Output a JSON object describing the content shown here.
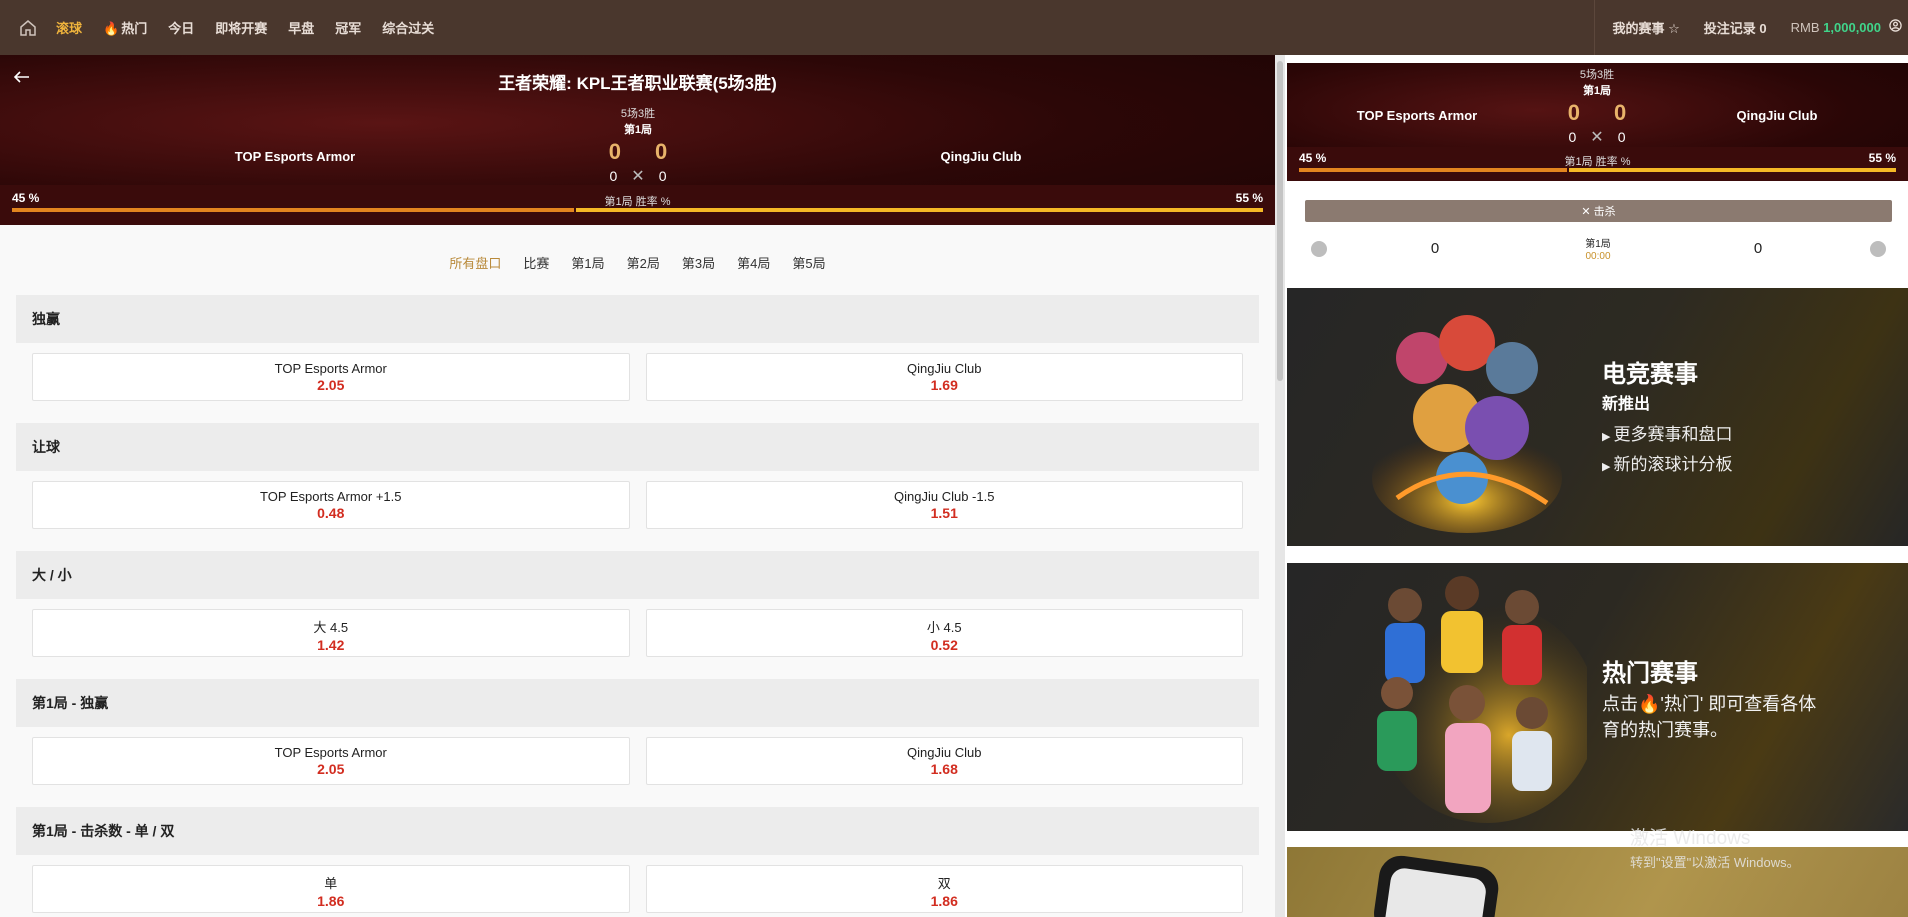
{
  "nav": {
    "items": [
      {
        "label": "滚球",
        "active": true
      },
      {
        "label": "热门",
        "icon": "fire-icon"
      },
      {
        "label": "今日"
      },
      {
        "label": "即将开赛"
      },
      {
        "label": "早盘"
      },
      {
        "label": "冠军"
      },
      {
        "label": "综合过关"
      }
    ],
    "my_events": "我的赛事",
    "bet_records": "投注记录 0",
    "currency": "RMB",
    "balance": "1,000,000"
  },
  "match": {
    "title": "王者荣耀: KPL王者职业联赛(5场3胜)",
    "format": "5场3胜",
    "round": "第1局",
    "home": "TOP Esports Armor",
    "away": "QingJiu Club",
    "home_round_score": "0",
    "away_round_score": "0",
    "home_score": "0",
    "away_score": "0",
    "home_pct_label": "45 %",
    "away_pct_label": "55 %",
    "home_pct": 45,
    "away_pct": 55,
    "prob_label": "第1局 胜率 %"
  },
  "tabs": [
    "所有盘口",
    "比赛",
    "第1局",
    "第2局",
    "第3局",
    "第4局",
    "第5局"
  ],
  "markets": [
    {
      "title": "独赢",
      "options": [
        {
          "name": "TOP Esports Armor",
          "odds": "2.05"
        },
        {
          "name": "QingJiu Club",
          "odds": "1.69"
        }
      ]
    },
    {
      "title": "让球",
      "options": [
        {
          "name": "TOP Esports Armor +1.5",
          "odds": "0.48"
        },
        {
          "name": "QingJiu Club -1.5",
          "odds": "1.51"
        }
      ]
    },
    {
      "title": "大 / 小",
      "options": [
        {
          "name": "大 4.5",
          "odds": "1.42"
        },
        {
          "name": "小 4.5",
          "odds": "0.52"
        }
      ]
    },
    {
      "title": "第1局 - 独赢",
      "options": [
        {
          "name": "TOP Esports Armor",
          "odds": "2.05"
        },
        {
          "name": "QingJiu Club",
          "odds": "1.68"
        }
      ]
    },
    {
      "title": "第1局 - 击杀数 - 单 / 双",
      "options": [
        {
          "name": "单",
          "odds": "1.86"
        },
        {
          "name": "双",
          "odds": "1.86"
        }
      ]
    }
  ],
  "kills": {
    "label": "击杀",
    "home": "0",
    "away": "0",
    "round": "第1局",
    "time": "00:00"
  },
  "promos": {
    "esports_title": "电竞赛事",
    "esports_sub": "新推出",
    "esports_b1": "更多赛事和盘口",
    "esports_b2": "新的滚球计分板",
    "hot_title": "热门赛事",
    "hot_text_pre": "点击",
    "hot_text_post": "'热门' 即可查看各体育的热门赛事。"
  },
  "watermark": {
    "line1": "激活 Windows",
    "line2": "转到\"设置\"以激活 Windows。"
  },
  "colors": {
    "nav_bg": "#4a372d",
    "active": "#f0b43c",
    "odds": "#d22d20",
    "balance": "#40d48a"
  }
}
